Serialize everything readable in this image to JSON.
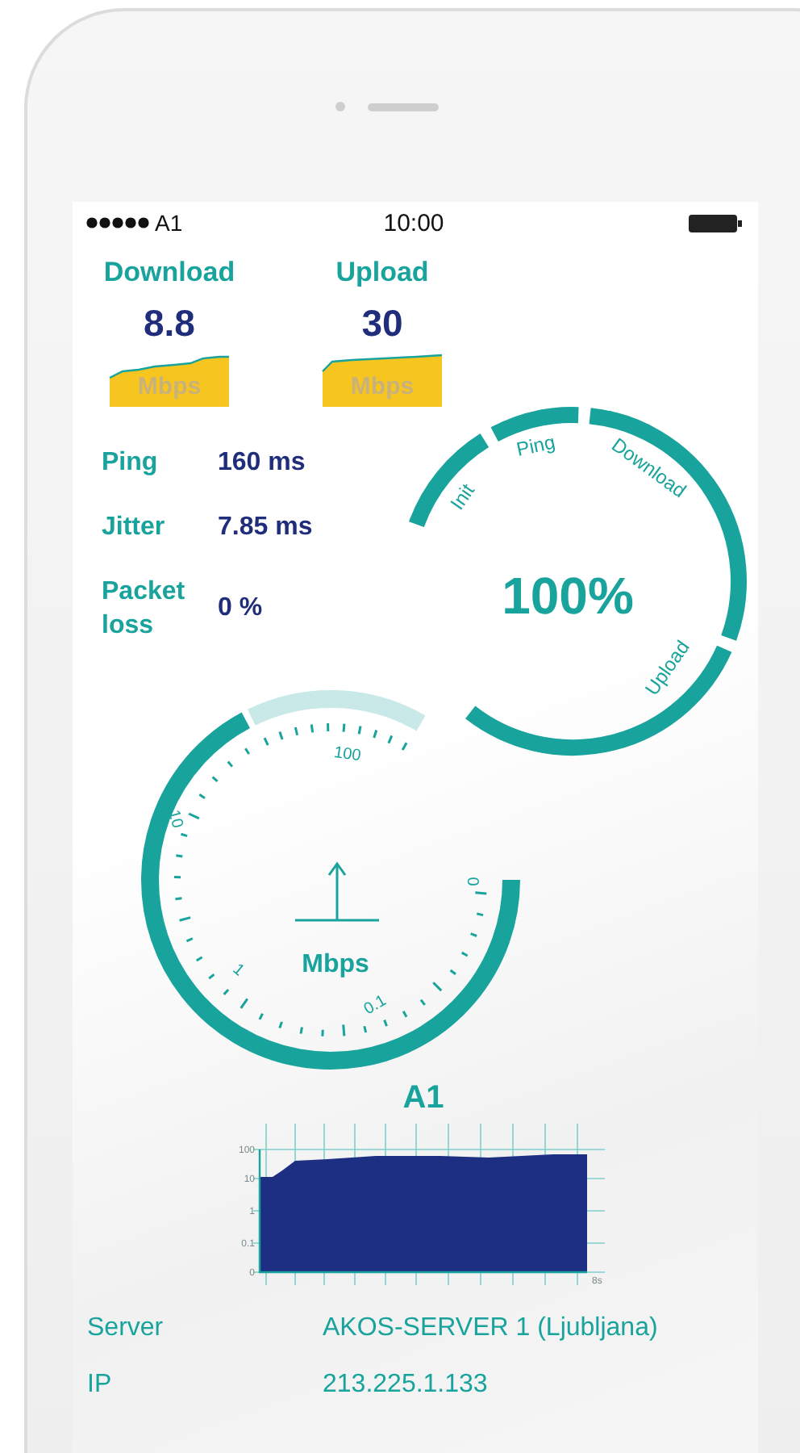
{
  "status_bar": {
    "carrier": "A1",
    "time": "10:00"
  },
  "results": [
    {
      "label": "Download",
      "value": "8.8",
      "unit": "Mbps"
    },
    {
      "label": "Upload",
      "value": "30",
      "unit": "Mbps"
    }
  ],
  "stats": [
    {
      "label": "Ping",
      "value": "160 ms"
    },
    {
      "label": "Jitter",
      "value": "7.85 ms"
    },
    {
      "label": "Packet loss",
      "value": "0 %"
    }
  ],
  "progress": {
    "phases": [
      "Init",
      "Ping",
      "Download",
      "Upload"
    ],
    "percent": "100%"
  },
  "speedometer": {
    "scale_labels": [
      "100",
      "10",
      "1",
      "0.1",
      "0"
    ],
    "unit": "Mbps"
  },
  "history_chart": {
    "title": "A1",
    "y_tick_labels": [
      "100",
      "10",
      "1",
      "0.1",
      "0"
    ],
    "x_tick_label": "8s"
  },
  "info": [
    {
      "label": "Server",
      "value": "AKOS-SERVER 1 (Ljubljana)"
    },
    {
      "label": "IP",
      "value": "213.225.1.133"
    }
  ]
}
